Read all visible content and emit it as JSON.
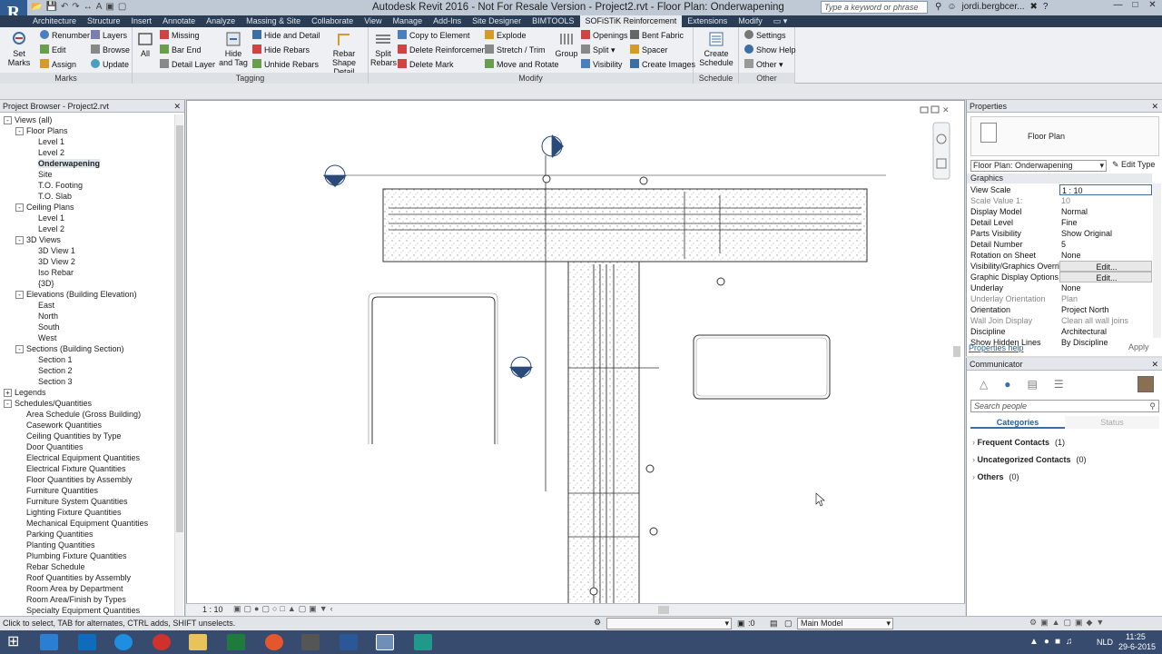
{
  "app": {
    "logo": "R",
    "title": "Autodesk Revit 2016 - Not For Resale Version -    Project2.rvt - Floor Plan: Onderwapening",
    "search_placeholder": "Type a keyword or phrase",
    "user": "jordi.bergbcer...",
    "window_controls": [
      "—",
      "□",
      "✕"
    ]
  },
  "tabs": [
    "Architecture",
    "Structure",
    "Insert",
    "Annotate",
    "Analyze",
    "Massing & Site",
    "Collaborate",
    "View",
    "Manage",
    "Add-Ins",
    "Site Designer",
    "BIMTOOLS",
    "SOFiSTiK Reinforcement",
    "Extensions",
    "Modify"
  ],
  "active_tab": "SOFiSTiK Reinforcement",
  "ribbon": {
    "marks": {
      "label": "Marks",
      "set_marks": "Set Marks",
      "renumber": "Renumber",
      "edit": "Edit",
      "assign": "Assign",
      "layers": "Layers",
      "browse": "Browse",
      "update": "Update"
    },
    "tagging": {
      "label": "Tagging",
      "all": "All",
      "missing": "Missing",
      "bar_end": "Bar End",
      "detail_layer": "Detail Layer",
      "hide_and_tag": "Hide and Tag",
      "hide_and_detail": "Hide and Detail",
      "hide_rebars": "Hide Rebars",
      "unhide_rebars": "Unhide Rebars",
      "rebar_shape_detail": "Rebar Shape Detail"
    },
    "modify": {
      "label": "Modify",
      "split_rebars": "Split Rebars",
      "copy_to_element": "Copy to Element",
      "delete_reinforcement": "Delete Reinforcement",
      "delete_mark": "Delete Mark",
      "explode": "Explode",
      "stretch_trim": "Stretch / Trim",
      "move_and_rotate": "Move and Rotate",
      "group": "Group",
      "openings": "Openings",
      "split": "Split",
      "visibility": "Visibility",
      "bent_fabric": "Bent Fabric",
      "spacer": "Spacer",
      "create_images": "Create Images"
    },
    "schedule": {
      "label": "Schedule",
      "create_schedule": "Create Schedule"
    },
    "other": {
      "label": "Other",
      "settings": "Settings",
      "show_help": "Show Help",
      "other": "Other"
    }
  },
  "browser": {
    "title": "Project Browser - Project2.rvt",
    "items": [
      {
        "t": "Views (all)",
        "lvl": 0,
        "tg": "-"
      },
      {
        "t": "Floor Plans",
        "lvl": 1,
        "tg": "-"
      },
      {
        "t": "Level 1",
        "lvl": 2
      },
      {
        "t": "Level 2",
        "lvl": 2
      },
      {
        "t": "Onderwapening",
        "lvl": 2,
        "sel": true
      },
      {
        "t": "Site",
        "lvl": 2
      },
      {
        "t": "T.O. Footing",
        "lvl": 2
      },
      {
        "t": "T.O. Slab",
        "lvl": 2
      },
      {
        "t": "Ceiling Plans",
        "lvl": 1,
        "tg": "-"
      },
      {
        "t": "Level 1",
        "lvl": 2
      },
      {
        "t": "Level 2",
        "lvl": 2
      },
      {
        "t": "3D Views",
        "lvl": 1,
        "tg": "-"
      },
      {
        "t": "3D View 1",
        "lvl": 2
      },
      {
        "t": "3D View 2",
        "lvl": 2
      },
      {
        "t": "Iso Rebar",
        "lvl": 2
      },
      {
        "t": "{3D}",
        "lvl": 2
      },
      {
        "t": "Elevations (Building Elevation)",
        "lvl": 1,
        "tg": "-"
      },
      {
        "t": "East",
        "lvl": 2
      },
      {
        "t": "North",
        "lvl": 2
      },
      {
        "t": "South",
        "lvl": 2
      },
      {
        "t": "West",
        "lvl": 2
      },
      {
        "t": "Sections (Building Section)",
        "lvl": 1,
        "tg": "-"
      },
      {
        "t": "Section 1",
        "lvl": 2
      },
      {
        "t": "Section 2",
        "lvl": 2
      },
      {
        "t": "Section 3",
        "lvl": 2
      },
      {
        "t": "Legends",
        "lvl": 0,
        "tg": "+"
      },
      {
        "t": "Schedules/Quantities",
        "lvl": 0,
        "tg": "-"
      },
      {
        "t": "Area Schedule (Gross Building)",
        "lvl": 1
      },
      {
        "t": "Casework Quantities",
        "lvl": 1
      },
      {
        "t": "Ceiling Quantities by Type",
        "lvl": 1
      },
      {
        "t": "Door Quantities",
        "lvl": 1
      },
      {
        "t": "Electrical Equipment Quantities",
        "lvl": 1
      },
      {
        "t": "Electrical Fixture Quantities",
        "lvl": 1
      },
      {
        "t": "Floor Quantities by Assembly",
        "lvl": 1
      },
      {
        "t": "Furniture Quantities",
        "lvl": 1
      },
      {
        "t": "Furniture System Quantities",
        "lvl": 1
      },
      {
        "t": "Lighting Fixture Quantities",
        "lvl": 1
      },
      {
        "t": "Mechanical Equipment Quantities",
        "lvl": 1
      },
      {
        "t": "Parking Quantities",
        "lvl": 1
      },
      {
        "t": "Planting Quantities",
        "lvl": 1
      },
      {
        "t": "Plumbing Fixture Quantities",
        "lvl": 1
      },
      {
        "t": "Rebar Schedule",
        "lvl": 1
      },
      {
        "t": "Roof Quantities by Assembly",
        "lvl": 1
      },
      {
        "t": "Room Area by Department",
        "lvl": 1
      },
      {
        "t": "Room Area/Finish by Types",
        "lvl": 1
      },
      {
        "t": "Specialty Equipment Quantities",
        "lvl": 1
      }
    ]
  },
  "view": {
    "scale": "1 : 10"
  },
  "properties": {
    "title": "Properties",
    "family": "Floor Plan",
    "instance": "Floor Plan: Onderwapening",
    "edit_type": "Edit Type",
    "group": "Graphics",
    "rows": [
      {
        "k": "View Scale",
        "v": "1 : 10",
        "ed": true
      },
      {
        "k": "Scale Value    1:",
        "v": "10",
        "dim": true
      },
      {
        "k": "Display Model",
        "v": "Normal"
      },
      {
        "k": "Detail Level",
        "v": "Fine"
      },
      {
        "k": "Parts Visibility",
        "v": "Show Original"
      },
      {
        "k": "Detail Number",
        "v": "5"
      },
      {
        "k": "Rotation on Sheet",
        "v": "None"
      },
      {
        "k": "Visibility/Graphics Overri...",
        "v": "Edit...",
        "btn": true
      },
      {
        "k": "Graphic Display Options",
        "v": "Edit...",
        "btn": true
      },
      {
        "k": "Underlay",
        "v": "None"
      },
      {
        "k": "Underlay Orientation",
        "v": "Plan",
        "dim": true
      },
      {
        "k": "Orientation",
        "v": "Project North"
      },
      {
        "k": "Wall Join Display",
        "v": "Clean all wall joins",
        "dim": true
      },
      {
        "k": "Discipline",
        "v": "Architectural"
      },
      {
        "k": "Show Hidden Lines",
        "v": "By Discipline"
      }
    ],
    "help": "Properties help",
    "apply": "Apply"
  },
  "communicator": {
    "title": "Communicator",
    "search_placeholder": "Search people",
    "tab_categories": "Categories",
    "tab_status": "Status",
    "groups": [
      {
        "name": "Frequent Contacts",
        "count": "(1)"
      },
      {
        "name": "Uncategorized Contacts",
        "count": "(0)"
      },
      {
        "name": "Others",
        "count": "(0)"
      }
    ]
  },
  "status": {
    "hint": "Click to select, TAB for alternates, CTRL adds, SHIFT unselects.",
    "coord": ":0",
    "model": "Main Model"
  },
  "taskbar": {
    "lang": "NLD",
    "time": "11:25",
    "date": "29-6-2015"
  },
  "colors": {
    "ribbon_tab_bg": "#2b3d55",
    "taskbar": "#364b6d",
    "accent": "#3a6ea5"
  }
}
